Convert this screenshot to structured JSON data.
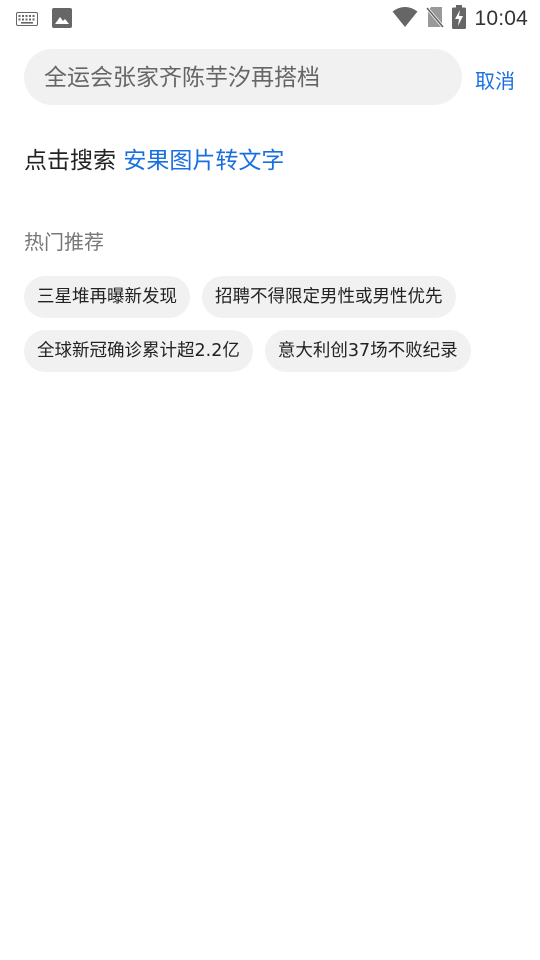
{
  "status_bar": {
    "time": "10:04",
    "left_icons": [
      "keyboard-icon",
      "image-icon"
    ],
    "right_icons": [
      "wifi-icon",
      "no-sim-icon",
      "battery-charging-icon"
    ]
  },
  "search": {
    "placeholder": "全运会张家齐陈芋汐再搭档",
    "value": "",
    "cancel_label": "取消"
  },
  "suggestion": {
    "prefix": "点击搜索",
    "keyword": "安果图片转文字"
  },
  "hot": {
    "title": "热门推荐",
    "tags": [
      "三星堆再曝新发现",
      "招聘不得限定男性或男性优先",
      "全球新冠确诊累计超2.2亿",
      "意大利创37场不败纪录"
    ]
  },
  "colors": {
    "accent": "#1a6fe0",
    "chip_bg": "#f1f1f1",
    "text": "#222222"
  }
}
